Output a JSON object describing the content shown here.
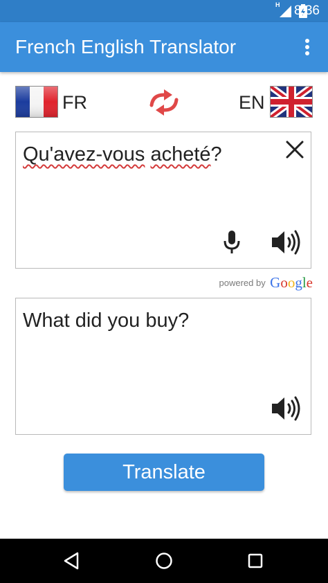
{
  "status_bar": {
    "time": "8:36",
    "signal_label": "H",
    "icons": [
      "signal-icon",
      "battery-icon"
    ]
  },
  "app_bar": {
    "title": "French English Translator",
    "menu_icon": "more-vert-icon"
  },
  "languages": {
    "source_code": "FR",
    "target_code": "EN",
    "source_flag": "france-flag-icon",
    "target_flag": "uk-flag-icon",
    "swap_icon": "swap-arrows-icon"
  },
  "input_box": {
    "words": [
      {
        "text": "Qu'avez-vous",
        "misspelled": true
      },
      {
        "text": " ",
        "misspelled": false
      },
      {
        "text": "acheté",
        "misspelled": true
      },
      {
        "text": "?",
        "misspelled": false
      }
    ],
    "icons": [
      "close-icon",
      "microphone-icon",
      "speaker-icon"
    ]
  },
  "powered_by": {
    "label": "powered by",
    "google_letters": [
      {
        "char": "G",
        "color": "#3b73e8"
      },
      {
        "char": "o",
        "color": "#d8372b"
      },
      {
        "char": "o",
        "color": "#f1b41c"
      },
      {
        "char": "g",
        "color": "#3b73e8"
      },
      {
        "char": "l",
        "color": "#2a9a46"
      },
      {
        "char": "e",
        "color": "#d8372b"
      }
    ]
  },
  "output_box": {
    "text": "What did you buy?",
    "icons": [
      "speaker-icon"
    ]
  },
  "translate_button": {
    "label": "Translate"
  },
  "nav_bar": {
    "icons": [
      "back-icon",
      "home-icon",
      "recents-icon"
    ]
  },
  "colors": {
    "status_bar": "#2f7ec7",
    "app_bar": "#3b8fdc",
    "button": "#3b8fdc",
    "swap_icon": "#e04848",
    "spellcheck_underline": "#d43b3b",
    "nav_bar": "#000000"
  }
}
